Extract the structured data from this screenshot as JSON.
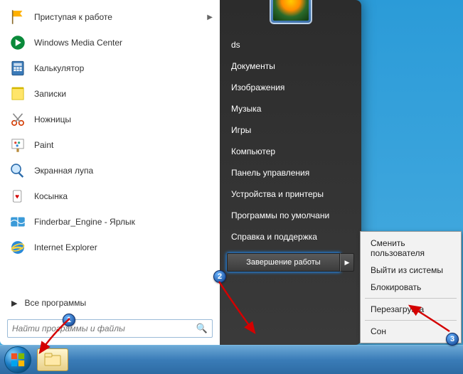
{
  "programs": [
    {
      "label": "Приступая к работе",
      "icon": "flag",
      "has_sub": true
    },
    {
      "label": "Windows Media Center",
      "icon": "wmc"
    },
    {
      "label": "Калькулятор",
      "icon": "calc"
    },
    {
      "label": "Записки",
      "icon": "notes"
    },
    {
      "label": "Ножницы",
      "icon": "snip"
    },
    {
      "label": "Paint",
      "icon": "paint"
    },
    {
      "label": "Экранная лупа",
      "icon": "magnifier"
    },
    {
      "label": "Косынка",
      "icon": "solitaire"
    },
    {
      "label": "Finderbar_Engine - Ярлык",
      "icon": "finder"
    },
    {
      "label": "Internet Explorer",
      "icon": "ie"
    }
  ],
  "all_programs": "Все программы",
  "search_placeholder": "Найти программы и файлы",
  "right_links": [
    "ds",
    "Документы",
    "Изображения",
    "Музыка",
    "Игры",
    "Компьютер",
    "Панель управления",
    "Устройства и принтеры",
    "Программы по умолчани",
    "Справка и поддержка"
  ],
  "shutdown_label": "Завершение работы",
  "power_menu": [
    "Сменить пользователя",
    "Выйти из системы",
    "Блокировать",
    "__sep__",
    "Перезагрузка",
    "__sep__",
    "Сон"
  ],
  "badges": {
    "b1": "1",
    "b2": "2",
    "b3": "3"
  }
}
